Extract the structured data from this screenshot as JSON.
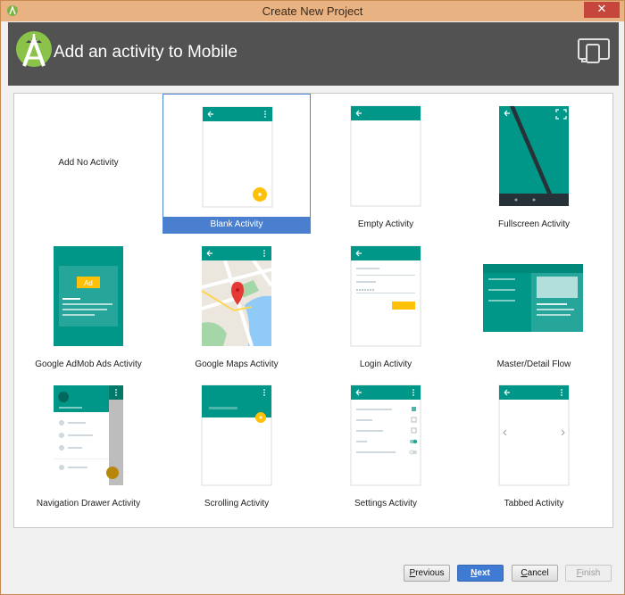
{
  "window": {
    "title": "Create New Project",
    "close_glyph": "✕",
    "colors": {
      "titlebar": "#e8b283",
      "close": "#c7463c"
    }
  },
  "header": {
    "title": "Add an activity to Mobile",
    "logo_icon": "android-studio-logo",
    "device_icon": "phone-tablet-icon",
    "background": "#525252"
  },
  "templates": [
    {
      "label": "Add No Activity",
      "thumb": "none"
    },
    {
      "label": "Blank Activity",
      "thumb": "blank",
      "selected": true
    },
    {
      "label": "Empty Activity",
      "thumb": "empty"
    },
    {
      "label": "Fullscreen Activity",
      "thumb": "fullscreen"
    },
    {
      "label": "Google AdMob Ads Activity",
      "thumb": "admob",
      "ad_text": "Ad"
    },
    {
      "label": "Google Maps Activity",
      "thumb": "maps"
    },
    {
      "label": "Login Activity",
      "thumb": "login"
    },
    {
      "label": "Master/Detail Flow",
      "thumb": "master_detail"
    },
    {
      "label": "Navigation Drawer Activity",
      "thumb": "nav_drawer"
    },
    {
      "label": "Scrolling Activity",
      "thumb": "scrolling"
    },
    {
      "label": "Settings Activity",
      "thumb": "settings"
    },
    {
      "label": "Tabbed Activity",
      "thumb": "tabbed"
    }
  ],
  "buttons": {
    "previous": {
      "first": "P",
      "rest": "revious"
    },
    "next": {
      "first": "N",
      "rest": "ext"
    },
    "cancel": {
      "first": "C",
      "rest": "ancel"
    },
    "finish": {
      "first": "F",
      "rest": "inish",
      "enabled": false
    }
  },
  "theme": {
    "teal": "#009688",
    "teal_dark": "#00796b",
    "amber": "#ffc107",
    "selection": "#4a7fd0"
  }
}
